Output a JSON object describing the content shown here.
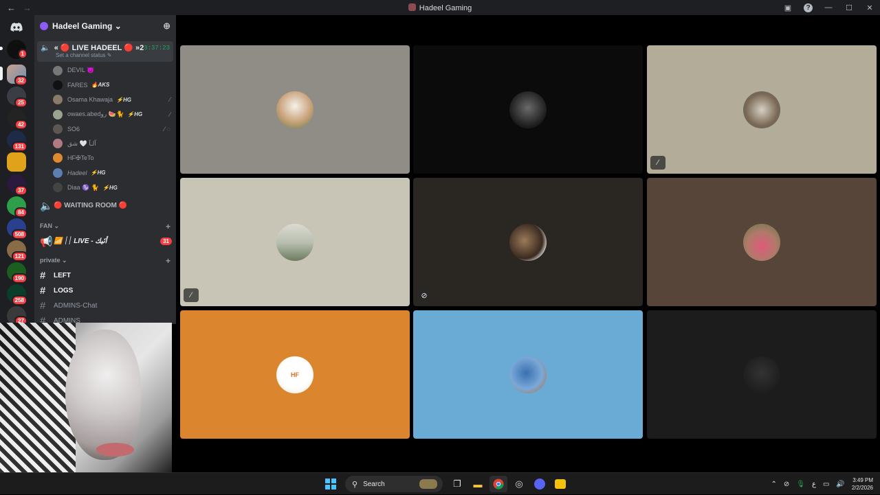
{
  "window": {
    "title": "Hadeel Gaming"
  },
  "server_badges": [
    "1",
    "32",
    "25",
    "42",
    "131",
    "37",
    "84",
    "508",
    "121",
    "190",
    "258",
    "27"
  ],
  "guild": {
    "name": "Hadeel Gaming ⌄"
  },
  "voice_channel": {
    "name": "« 🔴 LIVE HADEEL 🔴 »2",
    "timer": "3:37:23",
    "status": "Set a channel status ✎"
  },
  "members": [
    {
      "name": "DEVIL 😈",
      "tag": ""
    },
    {
      "name": "FARES",
      "tag": "🔥AKS"
    },
    {
      "name": "Osama Khawaja",
      "tag": "⚡HG"
    },
    {
      "name": "owaes.abedرو 🍉🐈",
      "tag": "⚡HG"
    },
    {
      "name": "SO6",
      "tag": ""
    },
    {
      "name": "آلـآ 🤍 شق",
      "tag": ""
    },
    {
      "name": "HF✠TeTo",
      "tag": ""
    },
    {
      "name": "Hadeel",
      "tag": "⚡HG"
    },
    {
      "name": "Diaa ♑ 🐈",
      "tag": "⚡HG"
    }
  ],
  "channels": {
    "waiting_room": "🔴 WAITING ROOM 🔴",
    "category_fan": "FAN ⌄",
    "live_channel": "📶 ׀׀ LIVE - أنَيك",
    "live_badge": "31",
    "category_private": "private ⌄",
    "left": "LEFT",
    "logs": "LOGS",
    "admins_chat": "ADMINS-Chat",
    "admins": "ADMINS"
  },
  "taskbar": {
    "search_placeholder": "Search",
    "time": "3:49 PM",
    "date": "2/2/2026",
    "lang": "ع"
  },
  "colors": {
    "tile_1": "#8f8d85",
    "tile_2": "#0b0b0b",
    "tile_3": "#b3ac98",
    "tile_4": "#c8c5b6",
    "tile_5": "#2a2723",
    "tile_6": "#574539",
    "tile_7": "#dc852f",
    "tile_8": "#69abd5",
    "tile_9": "#1c1c1c",
    "accent_red": "#f23f43",
    "accent_green": "#23a55a"
  }
}
